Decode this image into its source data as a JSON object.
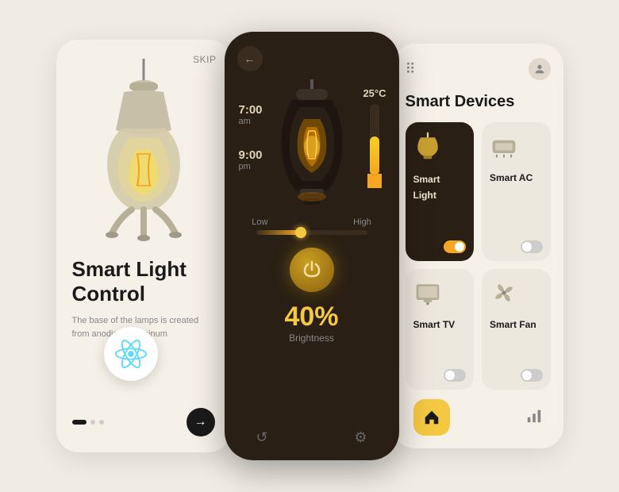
{
  "intro": {
    "skip_label": "SKIP",
    "title": "Smart Light\nControl",
    "description": "The base of the lamps is created from anodized aluminum",
    "arrow": "→",
    "dots": [
      "active",
      "inactive",
      "inactive"
    ]
  },
  "control": {
    "back_icon": "←",
    "schedule": [
      {
        "time": "7:00",
        "period": "am"
      },
      {
        "time": "9:00",
        "period": "pm"
      }
    ],
    "temperature": "25°C",
    "range_low": "Low",
    "range_high": "High",
    "brightness_percent": "40%",
    "brightness_label": "Brightness",
    "power_icon": "⏻"
  },
  "devices": {
    "title": "Smart Devices",
    "list": [
      {
        "name": "Smart Light",
        "icon": "💡",
        "active": true,
        "toggle": "on"
      },
      {
        "name": "Smart AC",
        "icon": "❄️",
        "active": false,
        "toggle": "off"
      },
      {
        "name": "Smart TV",
        "icon": "📺",
        "active": false,
        "toggle": "off"
      },
      {
        "name": "Smart Fan",
        "icon": "🌀",
        "active": false,
        "toggle": "off"
      }
    ],
    "nav_home": "🏠",
    "nav_chart": "📊"
  },
  "colors": {
    "dark_brown": "#2a1f14",
    "amber": "#f5a623",
    "warm_beige": "#f5f0e8",
    "react_blue": "#61DAFB"
  }
}
